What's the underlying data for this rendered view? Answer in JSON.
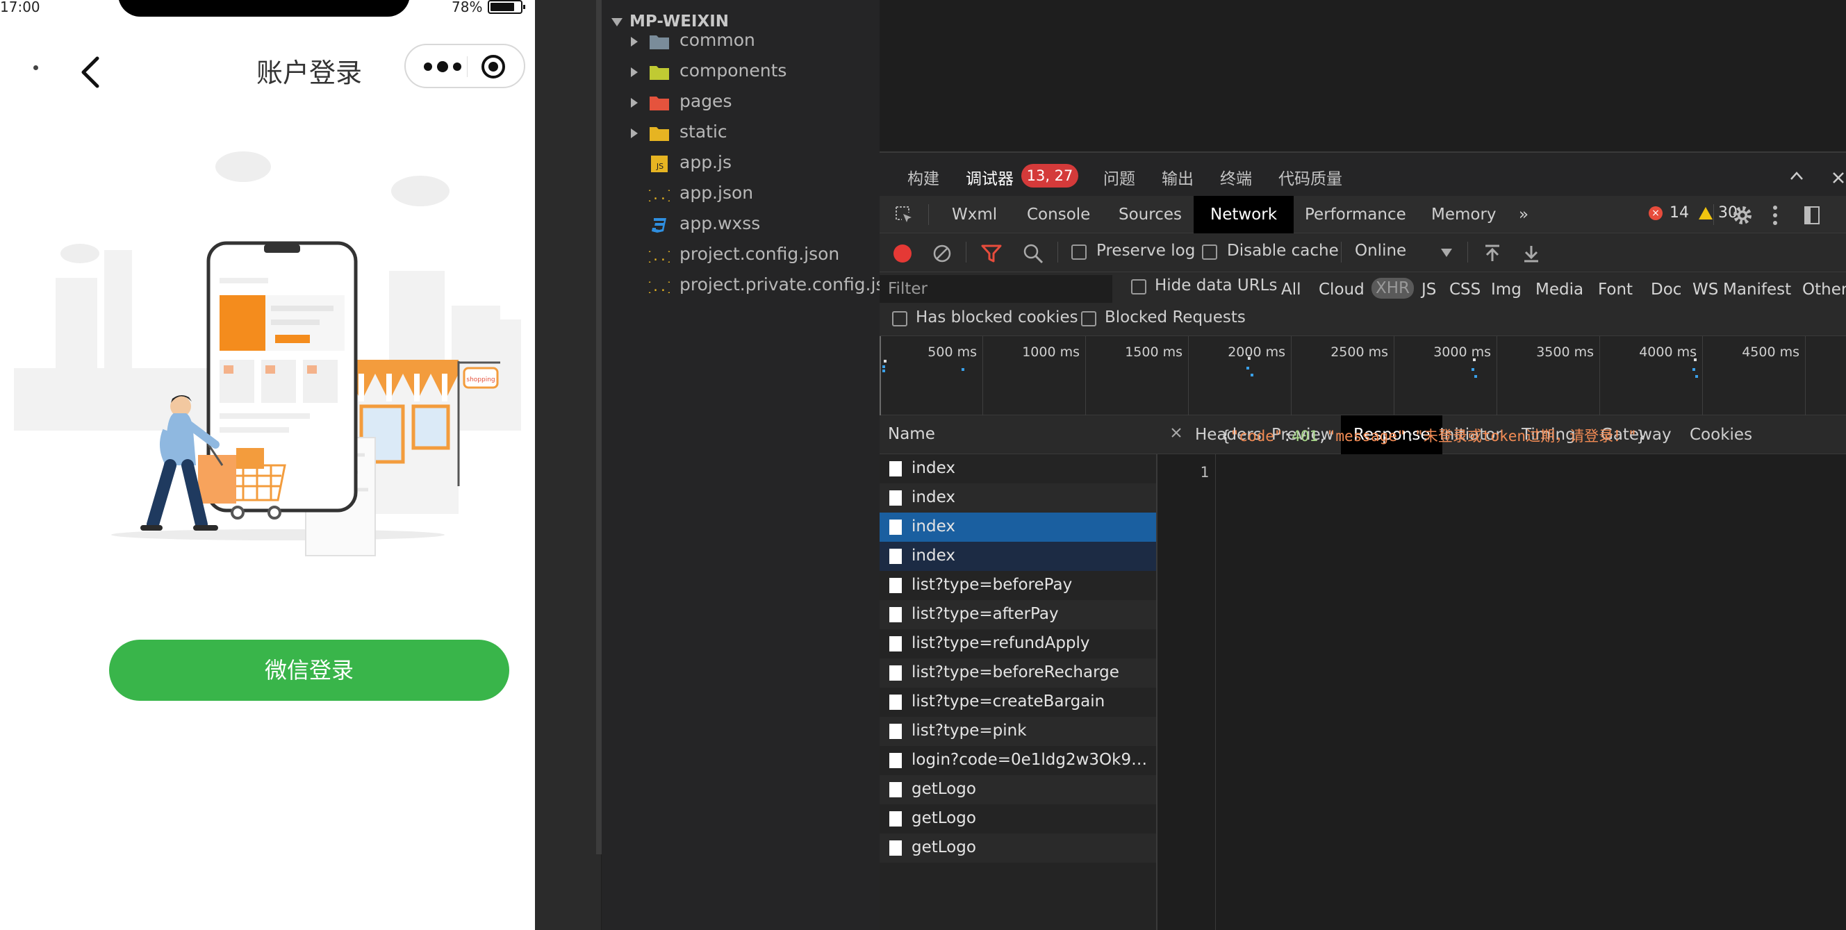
{
  "phone": {
    "status": {
      "time": "17:00",
      "battery_pct": "78%"
    },
    "nav_title": "账户登录",
    "login_button": "微信登录",
    "illustration_sign": "shopping"
  },
  "explorer": {
    "project": "MP-WEIXIN",
    "items": [
      {
        "label": "common",
        "type": "folder",
        "color": "#7a8c9a"
      },
      {
        "label": "components",
        "type": "folder",
        "color": "#c0ca33"
      },
      {
        "label": "pages",
        "type": "folder",
        "color": "#e5533d"
      },
      {
        "label": "static",
        "type": "folder",
        "color": "#e6b422"
      },
      {
        "label": "app.js",
        "type": "js"
      },
      {
        "label": "app.json",
        "type": "json"
      },
      {
        "label": "app.wxss",
        "type": "css"
      },
      {
        "label": "project.config.json",
        "type": "json"
      },
      {
        "label": "project.private.config.js...",
        "type": "json"
      }
    ]
  },
  "panel_tabs": {
    "build": "构建",
    "debugger": "调试器",
    "debugger_badge": "13, 27",
    "issues": "问题",
    "output": "输出",
    "terminal": "终端",
    "code_quality": "代码质量"
  },
  "devtools_tabs": [
    "Wxml",
    "Console",
    "Sources",
    "Network",
    "Performance",
    "Memory"
  ],
  "devtools_active": "Network",
  "more_tabs": "»",
  "counts": {
    "errors": "14",
    "warnings": "30"
  },
  "network_toolbar": {
    "preserve_log": "Preserve log",
    "disable_cache": "Disable cache",
    "throttling": "Online"
  },
  "filter": {
    "placeholder": "Filter",
    "hide_data_urls": "Hide data URLs",
    "types": [
      "All",
      "Cloud",
      "XHR",
      "JS",
      "CSS",
      "Img",
      "Media",
      "Font",
      "Doc",
      "WS",
      "Manifest",
      "Other"
    ],
    "active_type": "XHR",
    "has_blocked_cookies": "Has blocked cookies",
    "blocked_requests": "Blocked Requests"
  },
  "timeline": {
    "ticks": [
      "500 ms",
      "1000 ms",
      "1500 ms",
      "2000 ms",
      "2500 ms",
      "3000 ms",
      "3500 ms",
      "4000 ms",
      "4500 ms"
    ]
  },
  "requests": {
    "header": "Name",
    "rows": [
      "index",
      "index",
      "index",
      "index",
      "list?type=beforePay",
      "list?type=afterPay",
      "list?type=refundApply",
      "list?type=beforeRecharge",
      "list?type=createBargain",
      "list?type=pink",
      "login?code=0e1ldg2w3Ok945...",
      "getLogo",
      "getLogo",
      "getLogo"
    ],
    "selected_index": 2
  },
  "detail": {
    "tabs": [
      "Headers",
      "Preview",
      "Response",
      "Initiator",
      "Timing",
      "Gateway",
      "Cookies"
    ],
    "active_tab": "Response",
    "line_number": "1",
    "response": {
      "open": "{",
      "key1": "\"code\"",
      "colon1": ":",
      "val1": "401",
      "comma": ",",
      "key2": "\"message\"",
      "colon2": ":",
      "val2": "\"未登录或token过期，请登录！\"",
      "close": "}"
    }
  }
}
